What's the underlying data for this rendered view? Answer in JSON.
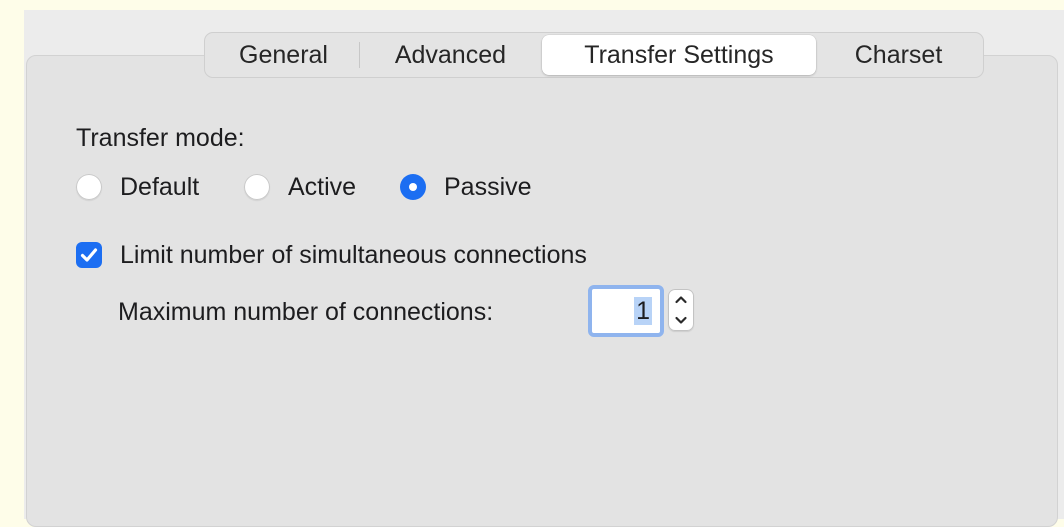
{
  "tabs": [
    {
      "label": "General",
      "selected": false
    },
    {
      "label": "Advanced",
      "selected": false
    },
    {
      "label": "Transfer Settings",
      "selected": true
    },
    {
      "label": "Charset",
      "selected": false
    }
  ],
  "transfer_mode": {
    "label": "Transfer mode:",
    "options": [
      {
        "label": "Default",
        "selected": false
      },
      {
        "label": "Active",
        "selected": false
      },
      {
        "label": "Passive",
        "selected": true
      }
    ]
  },
  "limit_connections": {
    "label": "Limit number of simultaneous connections",
    "checked": true
  },
  "max_connections": {
    "label": "Maximum number of connections:",
    "value": "1"
  },
  "colors": {
    "accent": "#1c6ef2",
    "page_background": "#fefde9",
    "panel_background": "#e3e3e3",
    "focus_ring": "#8fb4ee"
  }
}
